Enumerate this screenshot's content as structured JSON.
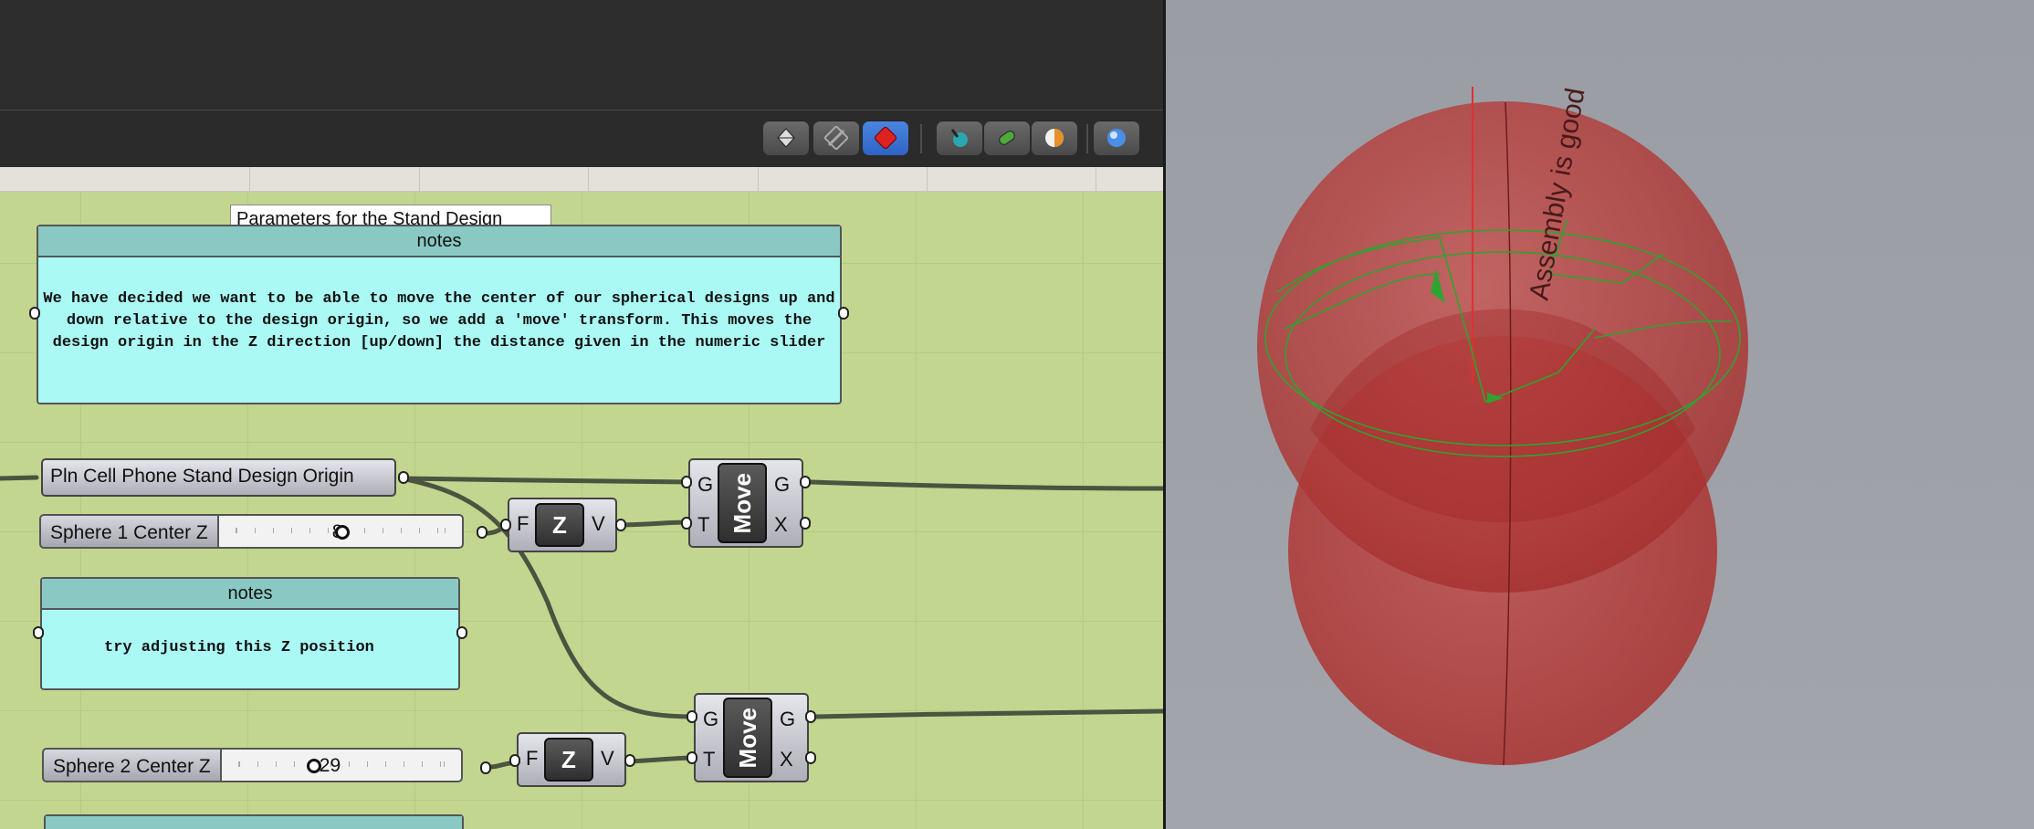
{
  "toolbar": {
    "buttons": [
      {
        "icon": "wireframe-preview-icon",
        "active": false
      },
      {
        "icon": "no-preview-icon",
        "active": false
      },
      {
        "icon": "shaded-preview-icon",
        "active": true
      },
      {
        "icon": "selected-only-icon",
        "active": false
      },
      {
        "icon": "preview-mesh-icon",
        "active": false
      },
      {
        "icon": "document-preview-settings-icon",
        "active": false
      },
      {
        "icon": "render-sphere-icon",
        "active": false
      }
    ]
  },
  "tooltip": {
    "text": "Parameters for the Stand Design"
  },
  "notes": [
    {
      "title": "notes",
      "body": "We have decided we want to be able to move the center of our spherical designs up and down relative to the design origin, so we add a 'move' transform. This moves the design origin in the Z direction [up/down] the distance given in the numeric slider"
    },
    {
      "title": "notes",
      "body": "try adjusting this Z position"
    }
  ],
  "components": {
    "origin_param": "Pln Cell Phone Stand Design Origin",
    "slider1": {
      "name": "Sphere 1 Center Z",
      "value": "8",
      "fraction": 0.5
    },
    "slider2": {
      "name": "Sphere 2 Center Z",
      "value": "-29",
      "fraction": 0.35
    },
    "unit_z_1": {
      "in": "F",
      "label": "Z",
      "out": "V"
    },
    "unit_z_2": {
      "in": "F",
      "label": "Z",
      "out": "V"
    },
    "move_1": {
      "in_g": "G",
      "in_t": "T",
      "label": "Move",
      "out_g": "G",
      "out_x": "X"
    },
    "move_2": {
      "in_g": "G",
      "in_t": "T",
      "label": "Move",
      "out_g": "G",
      "out_x": "X"
    }
  },
  "viewport": {
    "annotation": "Assembly is good",
    "sphere_color": "#b02a2a",
    "geometry_color": "#2fa32f",
    "background": "#9ea2a8"
  }
}
